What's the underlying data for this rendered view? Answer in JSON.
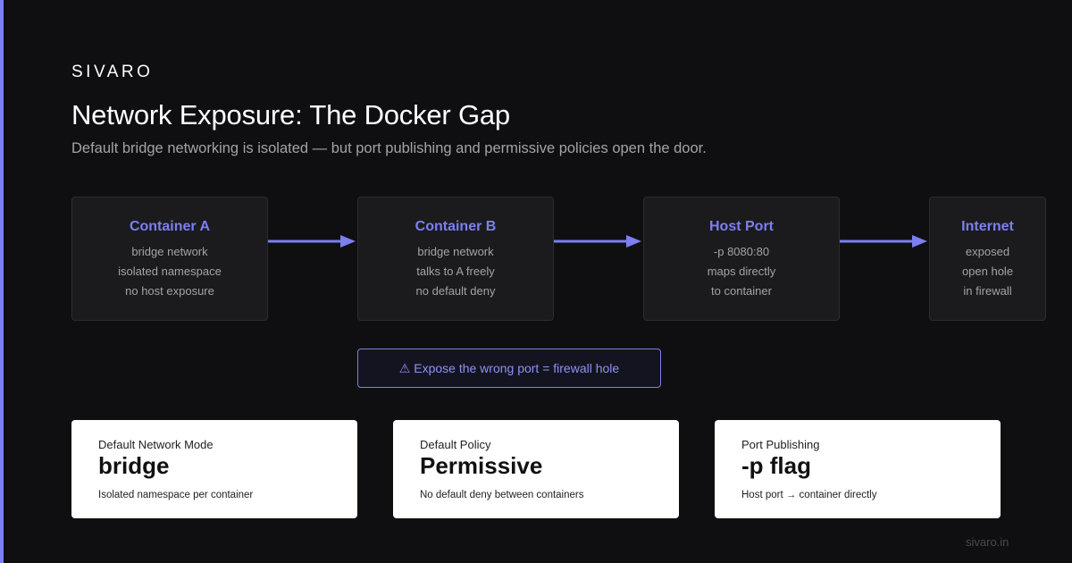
{
  "brand": "SIVARO",
  "title": "Network Exposure: The Docker Gap",
  "subtitle": "Default bridge networking is isolated — but port publishing and permissive policies open the door.",
  "flow": [
    {
      "title": "Container A",
      "lines": [
        "bridge network",
        "isolated namespace",
        "no host exposure"
      ]
    },
    {
      "title": "Container B",
      "lines": [
        "bridge network",
        "talks to A freely",
        "no default deny"
      ]
    },
    {
      "title": "Host Port",
      "lines": [
        "-p 8080:80",
        "maps directly",
        "to container"
      ]
    },
    {
      "title": "Internet",
      "lines": [
        "exposed",
        "open hole",
        "in firewall"
      ]
    }
  ],
  "warning": "⚠ Expose the wrong port = firewall hole",
  "stats": [
    {
      "label": "Default Network Mode",
      "value": "bridge",
      "desc": "Isolated namespace per container"
    },
    {
      "label": "Default Policy",
      "value": "Permissive",
      "desc": "No default deny between containers"
    },
    {
      "label": "Port Publishing",
      "value": "-p flag",
      "desc": "Host port → container directly"
    }
  ],
  "footer": "sivaro.in",
  "colors": {
    "accent": "#7c7ff0",
    "background": "#0f0f11",
    "card": "#1b1b1e"
  }
}
